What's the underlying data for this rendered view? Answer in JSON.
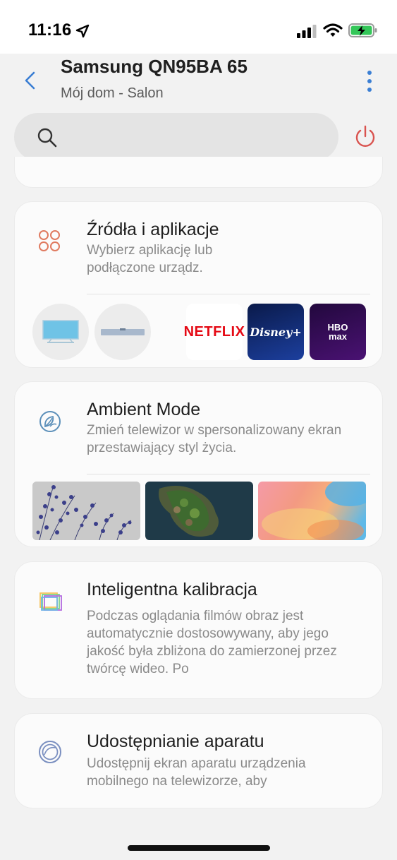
{
  "status_bar": {
    "time": "11:16",
    "icons": [
      "location-arrow-icon",
      "cellular-signal-icon",
      "wifi-icon",
      "battery-charging-icon"
    ]
  },
  "header": {
    "title": "Samsung QN95BA 65",
    "subtitle": "Mój dom - Salon",
    "search_placeholder": ""
  },
  "cards": {
    "sources": {
      "title": "Źródła i aplikacje",
      "description": "Wybierz aplikację lub podłączone urządz.",
      "apps": [
        {
          "label": "NETFLIX",
          "bg": "#ffffff",
          "color": "#e50914"
        },
        {
          "label": "Disney+",
          "bg": "#0f2a6e",
          "color": "#ffffff"
        },
        {
          "label": "HBO max",
          "bg": "#3a0f5c",
          "color": "#ffffff"
        }
      ]
    },
    "ambient": {
      "title": "Ambient Mode",
      "description": "Zmień telewizor w spersonalizowany ekran przestawiający styl życia."
    },
    "calibration": {
      "title": "Inteligentna kalibracja",
      "description": "Podczas oglądania filmów obraz jest automatycznie dostosowywany, aby jego jakość była zbliżona do zamierzonej przez twórcę wideo. Po"
    },
    "camera": {
      "title": "Udostępnianie aparatu",
      "description": "Udostępnij ekran aparatu urządzenia mobilnego na telewizorze, aby"
    }
  },
  "colors": {
    "accent_blue": "#3b7fd4",
    "power_red": "#d9534f",
    "background": "#f2f2f2",
    "card": "#fbfbfb"
  }
}
